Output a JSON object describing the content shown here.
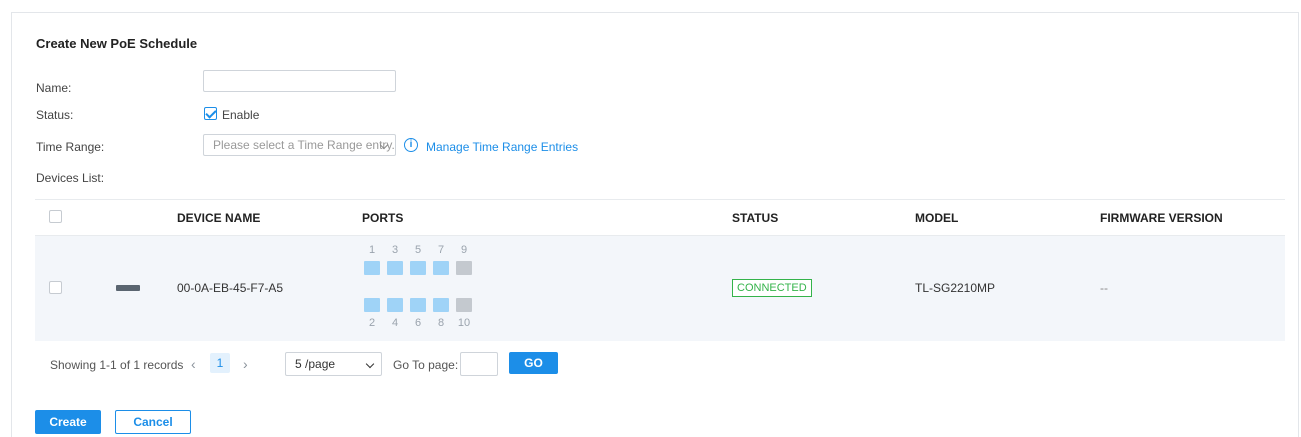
{
  "form": {
    "title": "Create New PoE Schedule",
    "name_label": "Name:",
    "name_value": "",
    "status_label": "Status:",
    "status_checkbox_label": "Enable",
    "status_checked": true,
    "time_range_label": "Time Range:",
    "time_range_placeholder": "Please select a Time Range entry.",
    "manage_link": "Manage Time Range Entries",
    "devices_label": "Devices List:"
  },
  "table": {
    "columns": [
      "DEVICE NAME",
      "PORTS",
      "STATUS",
      "MODEL",
      "FIRMWARE VERSION"
    ],
    "rows": [
      {
        "device_name": "00-0A-EB-45-F7-A5",
        "ports_top_numbers": [
          "1",
          "3",
          "5",
          "7",
          "9"
        ],
        "ports_bottom_numbers": [
          "2",
          "4",
          "6",
          "8",
          "10"
        ],
        "status": "CONNECTED",
        "model": "TL-SG2210MP",
        "firmware": "--"
      }
    ]
  },
  "pagination": {
    "summary": "Showing 1-1 of 1 records",
    "current_page": "1",
    "page_size": "5 /page",
    "goto_label": "Go To page:",
    "goto_value": "",
    "go_button": "GO"
  },
  "actions": {
    "create": "Create",
    "cancel": "Cancel"
  },
  "colors": {
    "accent": "#1c8ee8",
    "connected": "#34b34a",
    "port_active": "#9fd3f7",
    "port_inactive": "#c4c9cf"
  }
}
